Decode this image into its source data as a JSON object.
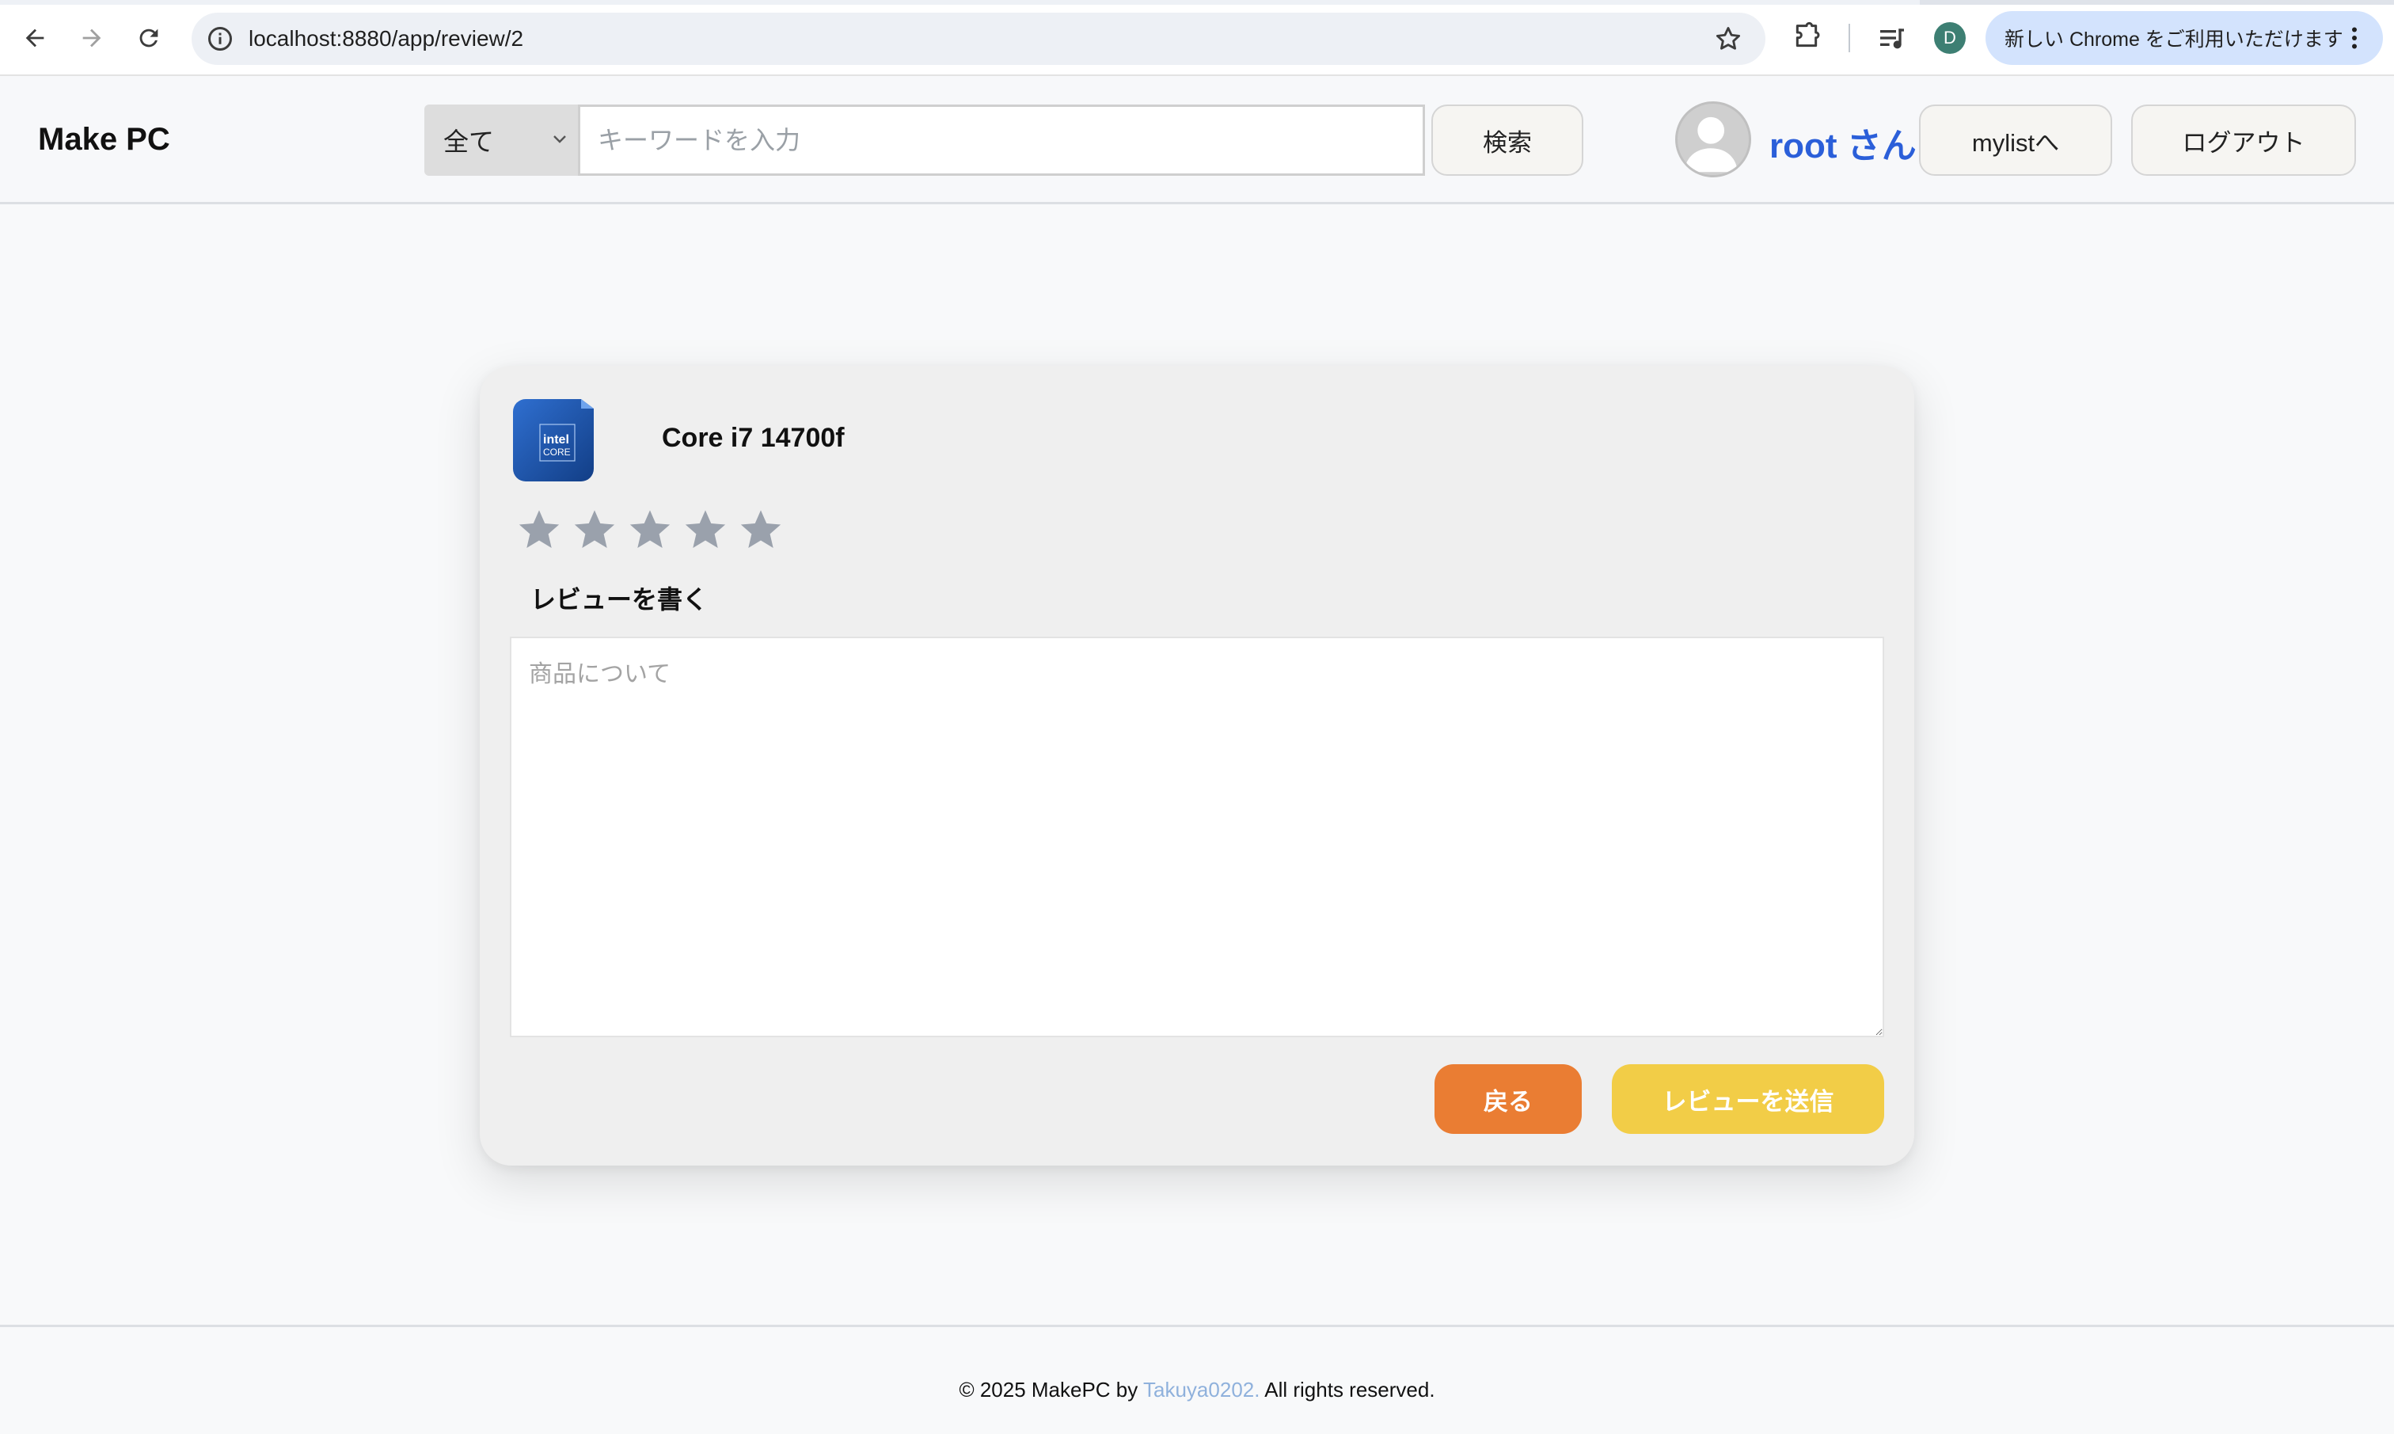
{
  "browser": {
    "url": "localhost:8880/app/review/2",
    "profile_initial": "D",
    "update_banner": "新しい Chrome をご利用いただけます"
  },
  "header": {
    "logo": "Make PC",
    "category": "全て",
    "search_placeholder": "キーワードを入力",
    "search_button": "検索",
    "username": "root さん",
    "mylist_button": "mylistへ",
    "logout_button": "ログアウト"
  },
  "review": {
    "product_name": "Core i7 14700f",
    "product_image_text": [
      "intel",
      "CORE"
    ],
    "rating": 0,
    "star_count": 5,
    "write_label": "レビューを書く",
    "text_placeholder": "商品について",
    "back_button": "戻る",
    "submit_button": "レビューを送信"
  },
  "footer": {
    "prefix": "© 2025 MakePC by ",
    "author": "Takuya0202.",
    "suffix": " All rights reserved."
  },
  "colors": {
    "username": "#2b5fd9",
    "back_button": "#ea7d33",
    "submit_button": "#f2cd47",
    "star_empty": "#9aa1ac",
    "footer_link": "#8fb1dc"
  }
}
